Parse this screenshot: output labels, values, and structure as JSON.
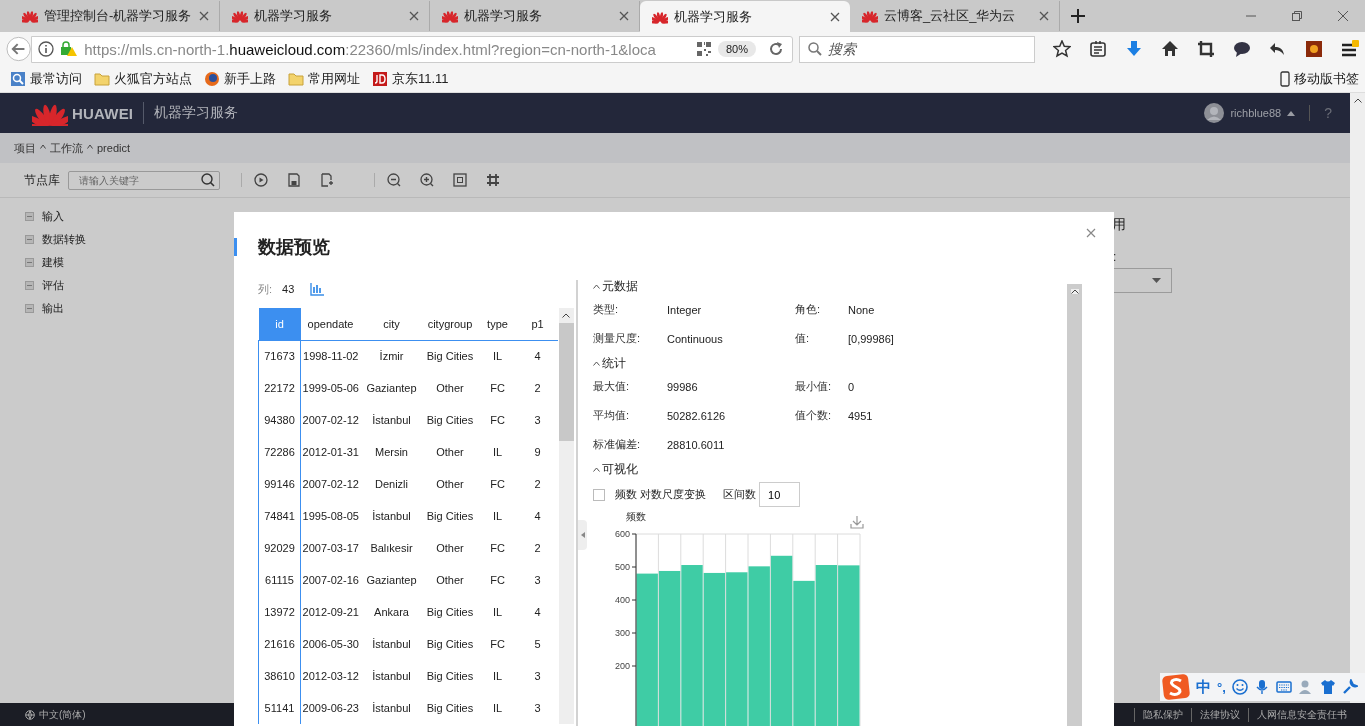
{
  "browser": {
    "tabs": [
      {
        "title": "管理控制台-机器学习服务",
        "selected": false
      },
      {
        "title": "机器学习服务",
        "selected": false
      },
      {
        "title": "机器学习服务",
        "selected": false
      },
      {
        "title": "机器学习服务",
        "selected": true
      },
      {
        "title": "云博客_云社区_华为云",
        "selected": false
      }
    ],
    "url": "https://mls.cn-north-1.**huaweicloud.com**:22360/mls/index.html?region=cn-north-1&loca",
    "zoom": "80%",
    "search_placeholder": "搜索",
    "bookmarks": [
      {
        "label": "最常访问",
        "kind": "page"
      },
      {
        "label": "火狐官方站点",
        "kind": "folder"
      },
      {
        "label": "新手上路",
        "kind": "globe"
      },
      {
        "label": "常用网址",
        "kind": "folder"
      },
      {
        "label": "京东11.11",
        "kind": "jd"
      }
    ],
    "mobile_bookmarks": "移动版书签"
  },
  "app": {
    "brand": "HUAWEI",
    "service": "机器学习服务",
    "user": "richblue88",
    "help": "?"
  },
  "breadcrumb": [
    "项目",
    "工作流",
    "predict"
  ],
  "toolbar": {
    "label": "节点库",
    "search_placeholder": "请输入关键字"
  },
  "sidebar": {
    "items": [
      "输入",
      "数据转换",
      "建模",
      "评估",
      "输出"
    ]
  },
  "right_panel": {
    "heading": "用",
    "label": ":"
  },
  "modal": {
    "title": "数据预览",
    "columns_label": "列:",
    "column_count": "43",
    "table": {
      "columns": [
        {
          "label": "id",
          "selected": true
        },
        {
          "label": "opendate",
          "selected": false
        },
        {
          "label": "city",
          "selected": false
        },
        {
          "label": "citygroup",
          "selected": false
        },
        {
          "label": "type",
          "selected": false
        },
        {
          "label": "p1",
          "selected": false
        }
      ],
      "rows": [
        [
          "71673",
          "1998-11-02",
          "İzmir",
          "Big Cities",
          "IL",
          "4"
        ],
        [
          "22172",
          "1999-05-06",
          "Gaziantep",
          "Other",
          "FC",
          "2"
        ],
        [
          "94380",
          "2007-02-12",
          "İstanbul",
          "Big Cities",
          "FC",
          "3"
        ],
        [
          "72286",
          "2012-01-31",
          "Mersin",
          "Other",
          "IL",
          "9"
        ],
        [
          "99146",
          "2007-02-12",
          "Denizli",
          "Other",
          "FC",
          "2"
        ],
        [
          "74841",
          "1995-08-05",
          "İstanbul",
          "Big Cities",
          "IL",
          "4"
        ],
        [
          "92029",
          "2007-03-17",
          "Balıkesir",
          "Other",
          "FC",
          "2"
        ],
        [
          "61115",
          "2007-02-16",
          "Gaziantep",
          "Other",
          "FC",
          "3"
        ],
        [
          "13972",
          "2012-09-21",
          "Ankara",
          "Big Cities",
          "IL",
          "4"
        ],
        [
          "21616",
          "2006-05-30",
          "İstanbul",
          "Big Cities",
          "FC",
          "5"
        ],
        [
          "38610",
          "2012-03-12",
          "İstanbul",
          "Big Cities",
          "IL",
          "3"
        ],
        [
          "51141",
          "2009-06-23",
          "İstanbul",
          "Big Cities",
          "IL",
          "3"
        ]
      ]
    },
    "sections": [
      {
        "title": "元数据",
        "expanded": true,
        "fields": [
          {
            "label": "类型:",
            "value": "Integer"
          },
          {
            "label": "角色:",
            "value": "None"
          },
          {
            "label": "测量尺度:",
            "value": "Continuous"
          },
          {
            "label": "值:",
            "value": "[0,99986]"
          }
        ]
      },
      {
        "title": "统计",
        "expanded": true,
        "fields": [
          {
            "label": "最大值:",
            "value": "99986"
          },
          {
            "label": "最小值:",
            "value": "0"
          },
          {
            "label": "平均值:",
            "value": "50282.6126"
          },
          {
            "label": "值个数:",
            "value": "4951"
          },
          {
            "label": "标准偏差:",
            "value": "28810.6011"
          }
        ]
      }
    ],
    "visualization": {
      "title": "可视化",
      "expanded": true,
      "log_scale": {
        "label": "频数 对数尺度变换",
        "checked": false
      },
      "bins_label": "区间数",
      "bins_value": "10",
      "chart_data": {
        "type": "bar",
        "ylabel": "频数",
        "series": [
          {
            "color": "#3fcca5",
            "values": [
              480,
              488,
              506,
              482,
              484,
              502,
              534,
              458,
              506,
              505
            ]
          }
        ],
        "ylim": [
          0,
          600
        ],
        "yticks": [
          200,
          300,
          400,
          500,
          600
        ]
      }
    }
  },
  "footer": {
    "language": "中文(简体)",
    "links": [
      "隐私保护",
      "法律协议",
      "人网信息安全责任书"
    ]
  },
  "ime": {
    "mode": "中",
    "punct": "°,"
  }
}
